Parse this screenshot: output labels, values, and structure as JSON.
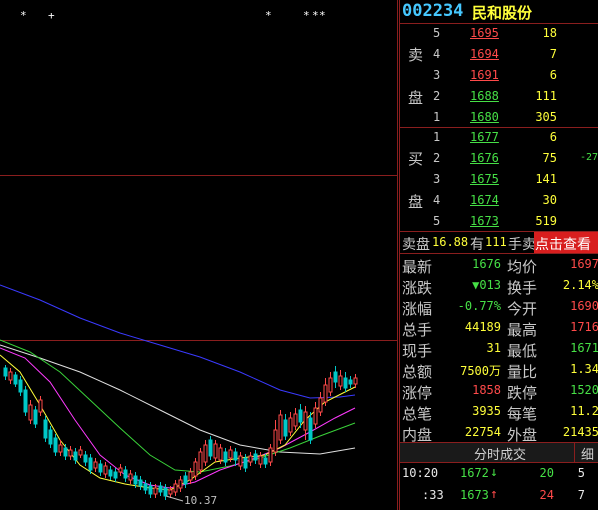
{
  "chart": {
    "low_label": "10.37",
    "marker_glyphs": [
      "*",
      "+",
      "*",
      "*",
      "*",
      "*"
    ]
  },
  "header": {
    "code": "002234",
    "name": "民和股份"
  },
  "sell": {
    "label_top": "卖",
    "label_bottom": "盘",
    "levels": [
      {
        "idx": "5",
        "price": "1695",
        "vol": "18"
      },
      {
        "idx": "4",
        "price": "1694",
        "vol": "7"
      },
      {
        "idx": "3",
        "price": "1691",
        "vol": "6"
      },
      {
        "idx": "2",
        "price": "1688",
        "vol": "111"
      },
      {
        "idx": "1",
        "price": "1680",
        "vol": "305"
      }
    ]
  },
  "buy": {
    "label_top": "买",
    "label_bottom": "盘",
    "levels": [
      {
        "idx": "1",
        "price": "1677",
        "vol": "6"
      },
      {
        "idx": "2",
        "price": "1676",
        "vol": "75",
        "extra": "-27"
      },
      {
        "idx": "3",
        "price": "1675",
        "vol": "141"
      },
      {
        "idx": "4",
        "price": "1674",
        "vol": "30"
      },
      {
        "idx": "5",
        "price": "1673",
        "vol": "519"
      }
    ]
  },
  "order_line": {
    "text_a": "卖盘",
    "price": "16.88",
    "text_b": "有",
    "vol": "111",
    "text_c": "手",
    "text_d": "卖",
    "link": "点击查看"
  },
  "stats": [
    {
      "l1": "最新",
      "v1": "1676",
      "l2": "均价",
      "v2": "1697"
    },
    {
      "l1": "涨跌",
      "v1": "▼013",
      "l2": "换手",
      "v2": "2.14%"
    },
    {
      "l1": "涨幅",
      "v1": "-0.77%",
      "l2": "今开",
      "v2": "1690"
    },
    {
      "l1": "总手",
      "v1": "44189",
      "l2": "最高",
      "v2": "1716"
    },
    {
      "l1": "现手",
      "v1": "31",
      "l2": "最低",
      "v2": "1671"
    },
    {
      "l1": "总额",
      "v1": "7500万",
      "l2": "量比",
      "v2": "1.34"
    },
    {
      "l1": "涨停",
      "v1": "1858",
      "l2": "跌停",
      "v2": "1520"
    },
    {
      "l1": "总笔",
      "v1": "3935",
      "l2": "每笔",
      "v2": "11.2"
    },
    {
      "l1": "内盘",
      "v1": "22754",
      "l2": "外盘",
      "v2": "21435"
    }
  ],
  "ticks": {
    "tab_label": "分时成交",
    "tab2_label": "细",
    "rows": [
      {
        "time": "10:20",
        "price": "1672",
        "arrow": "↓",
        "vol": "20",
        "count": "5"
      },
      {
        "time": ":33",
        "price": "1673",
        "arrow": "↑",
        "vol": "24",
        "count": "7"
      }
    ]
  },
  "colors": {
    "up": "#ff4a4a",
    "down": "#46e046",
    "neutral": "#ffff3a",
    "grid": "#8a1e1e",
    "ma_white": "#e0e0e0",
    "ma_yellow": "#ffff3a",
    "ma_magenta": "#ff3aff",
    "ma_green": "#3ad23a",
    "ma_blue": "#3a3aff"
  }
}
